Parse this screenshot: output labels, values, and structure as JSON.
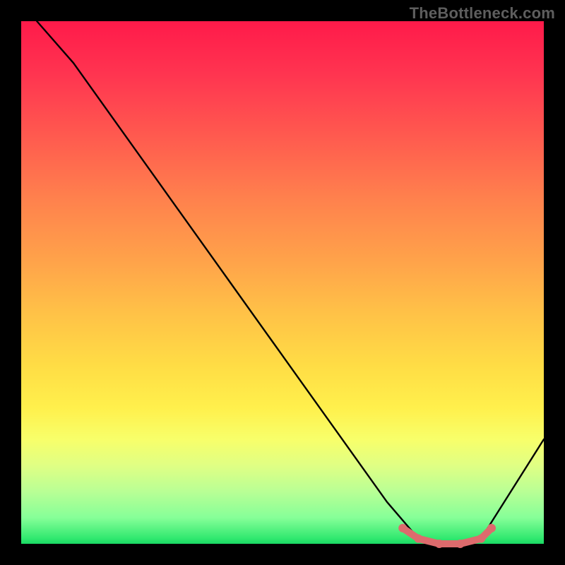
{
  "watermark": "TheBottleneck.com",
  "chart_data": {
    "type": "line",
    "title": "",
    "xlabel": "",
    "ylabel": "",
    "xlim": [
      0,
      100
    ],
    "ylim": [
      0,
      100
    ],
    "series": [
      {
        "name": "curve",
        "color": "#000000",
        "x": [
          3,
          10,
          20,
          30,
          40,
          50,
          60,
          70,
          76,
          80,
          84,
          88,
          100
        ],
        "y": [
          100,
          92,
          78,
          64,
          50,
          36,
          22,
          8,
          1,
          0,
          0,
          1,
          20
        ]
      }
    ],
    "highlighted_range": {
      "name": "optimal-band",
      "color": "#dd6b6d",
      "x": [
        73,
        76,
        80,
        84,
        88,
        90
      ],
      "y": [
        3,
        1,
        0,
        0,
        1,
        3
      ]
    },
    "gradient_stops": [
      {
        "pos": 0,
        "color": "#ff1a4a"
      },
      {
        "pos": 0.5,
        "color": "#ffc247"
      },
      {
        "pos": 0.8,
        "color": "#fff04c"
      },
      {
        "pos": 1.0,
        "color": "#19d863"
      }
    ]
  }
}
